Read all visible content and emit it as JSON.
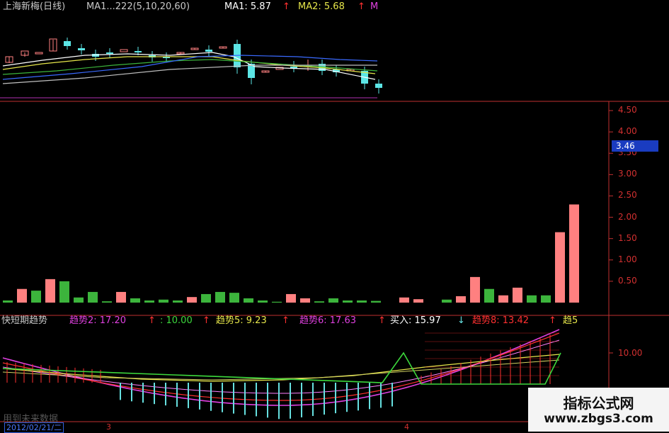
{
  "colors": {
    "background": "#000000",
    "up": "#ff8080",
    "down": "#5ce6e6",
    "volume_up": "#ff8080",
    "volume_down": "#3cb43c",
    "axis": "#c03030",
    "ma1": "#ffffff",
    "ma2": "#e6e64a",
    "ma3": "#e040e0",
    "ma4": "#3a6aff",
    "trend_magenta": "#e040e0",
    "trend_red": "#ff3030",
    "trend_yellow": "#e6e64a",
    "trend_green": "#3cd83c",
    "trend_cyan": "#66e0e0",
    "price_tag_bg": "#1a3cc0"
  },
  "main_header": {
    "stock": "上海新梅(日线)",
    "ma_label": "MA1...222(5,10,20,60)",
    "ma1": "MA1: 5.87",
    "ma1_arrow": "↑",
    "ma2": "MA2: 5.68",
    "ma2_arrow": "↑",
    "ma3_partial": "M"
  },
  "volume_axis": {
    "ticks": [
      "4.50",
      "4.00",
      "3.50",
      "3.00",
      "2.50",
      "2.00",
      "1.50",
      "1.00",
      "0.50"
    ],
    "current_value": "3.46"
  },
  "indicator_header": {
    "name": "快短期趋势",
    "t2_label": "趋势2: 17.20",
    "t2_arrow": "↑",
    "t3_label": ": 10.00",
    "t3_arrow": "↑",
    "t5_label": "趋势5: 9.23",
    "t5_arrow": "↑",
    "t6_label": "趋势6: 17.63",
    "t6_arrow": "↑",
    "buy_label": "买入: 15.97",
    "buy_arrow": "↓",
    "t8_label": "趋势8: 13.42",
    "t8_arrow": "↑",
    "t9_partial": "趋5"
  },
  "indicator_axis": {
    "tick": "10.00"
  },
  "footer": {
    "future_data": "用到未来数据",
    "date": "2012/02/21/二",
    "marker_3": "3",
    "marker_4": "4"
  },
  "watermark": {
    "title": "指标公式网",
    "url": "www.zbgs3.com"
  },
  "volume_bars": [
    {
      "v": 0.05,
      "up": false
    },
    {
      "v": 0.32,
      "up": true
    },
    {
      "v": 0.28,
      "up": false
    },
    {
      "v": 0.55,
      "up": true
    },
    {
      "v": 0.5,
      "up": false
    },
    {
      "v": 0.12,
      "up": false
    },
    {
      "v": 0.25,
      "up": false
    },
    {
      "v": 0.03,
      "up": false
    },
    {
      "v": 0.25,
      "up": true
    },
    {
      "v": 0.1,
      "up": false
    },
    {
      "v": 0.05,
      "up": false
    },
    {
      "v": 0.07,
      "up": false
    },
    {
      "v": 0.05,
      "up": false
    },
    {
      "v": 0.13,
      "up": true
    },
    {
      "v": 0.2,
      "up": false
    },
    {
      "v": 0.25,
      "up": false
    },
    {
      "v": 0.23,
      "up": false
    },
    {
      "v": 0.1,
      "up": false
    },
    {
      "v": 0.05,
      "up": false
    },
    {
      "v": 0.02,
      "up": false
    },
    {
      "v": 0.2,
      "up": true
    },
    {
      "v": 0.1,
      "up": true
    },
    {
      "v": 0.03,
      "up": false
    },
    {
      "v": 0.1,
      "up": false
    },
    {
      "v": 0.05,
      "up": false
    },
    {
      "v": 0.05,
      "up": false
    },
    {
      "v": 0.04,
      "up": false
    },
    {
      "v": 0.0,
      "up": false
    },
    {
      "v": 0.12,
      "up": true
    },
    {
      "v": 0.08,
      "up": true
    },
    {
      "v": 0.0,
      "up": false
    },
    {
      "v": 0.07,
      "up": false
    },
    {
      "v": 0.15,
      "up": true
    },
    {
      "v": 0.6,
      "up": true
    },
    {
      "v": 0.32,
      "up": false
    },
    {
      "v": 0.17,
      "up": true
    },
    {
      "v": 0.35,
      "up": true
    },
    {
      "v": 0.17,
      "up": false
    },
    {
      "v": 0.17,
      "up": false
    },
    {
      "v": 1.65,
      "up": true
    },
    {
      "v": 2.3,
      "up": true
    }
  ]
}
